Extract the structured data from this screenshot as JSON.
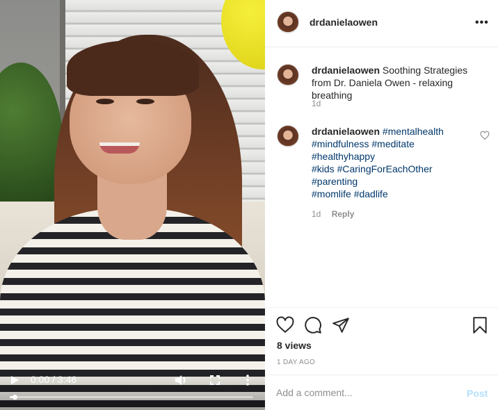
{
  "video": {
    "time_label": "0:00 / 3:46",
    "progress": 0.0,
    "buffered": 0.02
  },
  "post": {
    "username": "drdanielaowen",
    "options_label": "•••"
  },
  "caption": {
    "username": "drdanielaowen",
    "text": "Soothing Strategies from Dr. Daniela Owen - relaxing breathing",
    "age": "1d"
  },
  "comment": {
    "username": "drdanielaowen",
    "tags": [
      "#mentalhealth",
      "#mindfulness",
      "#meditate",
      "#healthyhappy",
      "#kids",
      "#CaringForEachOther",
      "#parenting",
      "#momlife",
      "#dadlife"
    ],
    "age": "1d",
    "reply_label": "Reply"
  },
  "actions": {
    "icons": [
      "heart-icon",
      "comment-icon",
      "share-icon",
      "bookmark-icon"
    ]
  },
  "stats": {
    "views": "8 views",
    "date": "1 DAY AGO"
  },
  "composer": {
    "placeholder": "Add a comment...",
    "post_label": "Post",
    "post_color": "#b2dffc"
  },
  "colors": {
    "hashtag": "#00376b",
    "muted": "#8e8e8e",
    "text": "#262626"
  }
}
